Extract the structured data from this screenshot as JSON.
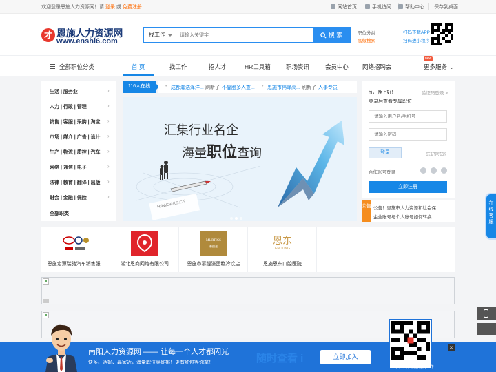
{
  "topbar": {
    "welcome": "欢迎登录恩施人力资源网！请",
    "login": "登录",
    "or": "或",
    "register": "免费注册",
    "links": [
      "网站首页",
      "手机访问",
      "帮助中心",
      "保存到桌面"
    ]
  },
  "logo": {
    "cn": "恩施人力资源网",
    "url": "www.enshi6.com"
  },
  "search": {
    "category": "找工作",
    "placeholder": "请输入关键字",
    "button": "搜 索"
  },
  "header_links": {
    "classify": "职位分类",
    "advanced": "高级搜索",
    "app": "扫码下载APP",
    "mini": "扫码进小程序"
  },
  "nav": {
    "all": "全部职位分类",
    "items": [
      "首 页",
      "找工作",
      "招人才",
      "HR工具箱",
      "职场资讯",
      "会员中心",
      "网络招聘会"
    ],
    "more": "更多服务",
    "new_badge": "new"
  },
  "categories": [
    "生活 | 服务业",
    "人力 | 行政 | 管理",
    "销售 | 客服 | 采购 | 淘宝",
    "市场 | 媒介 | 广告 | 设计",
    "生产 | 物流 | 质控 | 汽车",
    "网络 | 通信 | 电子",
    "法律 | 教育 | 翻译 | 出版",
    "财会 | 金融 | 保险",
    "全部职类"
  ],
  "online": "116人在线",
  "ticker": [
    {
      "company": "成都瀚浩泽洋...",
      "action": "刷新了",
      "job": "不靠脸多人查..."
    },
    {
      "company": "恩施市伟峰高...",
      "action": "刷新了",
      "job": "人事专员"
    }
  ],
  "banner": {
    "line1": "汇集行业名企",
    "line2a": "海量",
    "line2b": "职位",
    "line2c": "查询",
    "card": "HRWORKS.CN"
  },
  "login": {
    "greeting": "hi，晚上好!",
    "code_login": "验证码登录 >",
    "subtitle": "登录后查看专属职位",
    "user_ph": "请输入用户名/手机号",
    "pwd_ph": "请输入密码",
    "login_btn": "登录",
    "forgot": "忘记密码?",
    "other": "合作账号登录",
    "register": "立即注册"
  },
  "notice": {
    "tag": "公告",
    "items": [
      "公告！恩施市人力资源和社会保...",
      "企业账号与个人账号如何转换"
    ]
  },
  "companies": [
    {
      "name": "恩施宏源瑞驰汽车销售服...",
      "logo_text": "KIA · VW"
    },
    {
      "name": "湖北恩商网络有限公司",
      "logo_text": ""
    },
    {
      "name": "恩施市慕缇滋蛋糕冷饮店",
      "logo_text": "MURTICS"
    },
    {
      "name": "恩施恩东口腔医院",
      "logo_text": "恩东"
    }
  ],
  "company_logo_sub": {
    "murtics_cn": "慕缇滋",
    "endong_en": "ENDONG"
  },
  "side": {
    "service": "在线客服"
  },
  "bottom": {
    "title": "南阳人力资源网 —— 让每一个人才都闪光",
    "subtitle": "快多、活好、离家近，海量职位等你挑！更有红包等你拿！",
    "watermark": "随时查看 i",
    "join": "立即加入",
    "qr_caption": "扫一扫手机也能找工作",
    "close": "×"
  },
  "colors": {
    "accent": "#1787e6",
    "orange": "#ff6a00",
    "notice": "#f58d1e",
    "bottom": "#1f73d9"
  }
}
